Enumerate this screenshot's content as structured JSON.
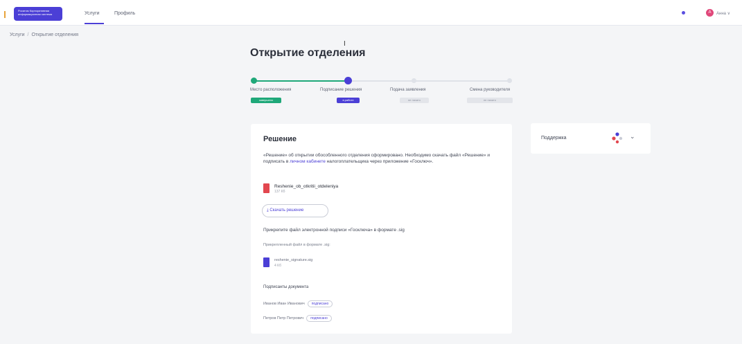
{
  "header": {
    "logo_text": "Росатом Корпоративная информационная система",
    "nav": [
      {
        "label": "Услуги",
        "active": true
      },
      {
        "label": "Профиль",
        "active": false
      }
    ],
    "user_initial": "А",
    "user_name": "Анна ∨"
  },
  "breadcrumb": [
    "Услуги",
    "Открытие отделения"
  ],
  "page_title": "Открытие отделения",
  "stepper": {
    "steps": [
      {
        "label": "Место расположения",
        "badge": "завершено",
        "state": "done"
      },
      {
        "label": "Подписание решения",
        "badge": "в работе",
        "state": "active"
      },
      {
        "label": "Подача заявления",
        "badge": "не начато",
        "state": "todo"
      },
      {
        "label": "Смена руководителя",
        "badge": "не начато",
        "state": "todo"
      }
    ]
  },
  "decision_card": {
    "title": "Решение",
    "description_before": "«Решение» об открытии обособленного отделения сформировано. Необходимо скачать файл «Решение» и подписать в ",
    "description_link": "личном кабинете",
    "description_after": " налогоплательщика через приложение «Госключ».",
    "file": {
      "name": "Reshenie_ob_otkritii_otdeleniya",
      "size": "137 Кб"
    },
    "download_label": "⤓  Скачать решение",
    "upload_title": "Прикрепите файл электронной подписи «Госключа» в формате .sig",
    "upload_hint": "Прикрепленный файл в формате .sig:",
    "sig_file": {
      "name": "reshenie_signature.sig",
      "size": "4 Кб"
    },
    "signers_title": "Подписанты документа",
    "signers": [
      {
        "name": "Иванов Иван Иванович",
        "status": "подписано"
      },
      {
        "name": "Петров Петр Петрович",
        "status": "подписано"
      }
    ]
  },
  "support_card": {
    "label": "Поддержка",
    "chevron": "⌄"
  },
  "colors": {
    "brand": "#4b3fd6",
    "done": "#1fa879",
    "todo": "#dfe2e8",
    "file_red": "#e2474f",
    "file_blue": "#4b3fd6"
  }
}
